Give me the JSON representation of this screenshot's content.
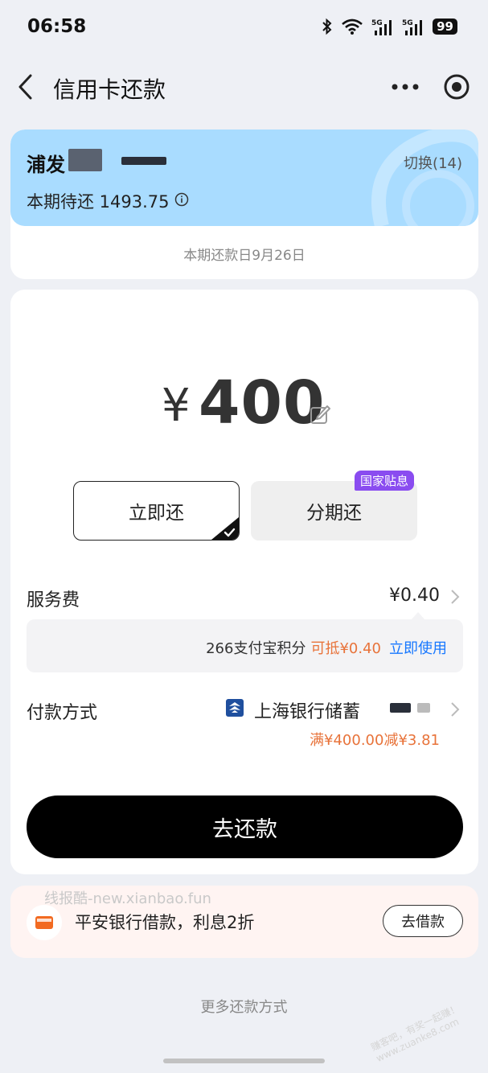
{
  "status_bar": {
    "time": "06:58",
    "battery": "99"
  },
  "nav": {
    "title": "信用卡还款"
  },
  "card": {
    "bank_name": "浦发",
    "switch_label": "切换(14)",
    "due_amount": "本期待还 1493.75",
    "due_date": "本期还款日9月26日"
  },
  "repay": {
    "currency": "¥",
    "amount": "400",
    "option_now": "立即还",
    "option_installment": "分期还",
    "subsidy_badge": "国家贴息"
  },
  "service_fee": {
    "label": "服务费",
    "value": "¥0.40",
    "points_text": "266支付宝积分",
    "points_deduct": "可抵¥0.40",
    "points_use": "立即使用"
  },
  "payment": {
    "label": "付款方式",
    "bank": "上海银行储蓄",
    "promo": "满¥400.00减¥3.81"
  },
  "submit_label": "去还款",
  "loan": {
    "watermark": "线报酷-new.xianbao.fun",
    "text": "平安银行借款，利息2折",
    "button": "去借款"
  },
  "more_methods": "更多还款方式",
  "corner_watermark": "赚客吧，有奖一起赚！ www.zuanke8.com",
  "colors": {
    "accent_blue": "#1677ff",
    "promo_orange": "#e8733a",
    "card_blue": "#a9dcff",
    "badge_purple": "#8a4cf0"
  }
}
